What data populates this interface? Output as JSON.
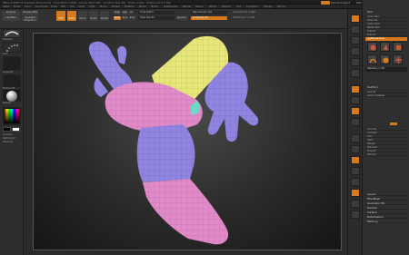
{
  "titlebar": {
    "app_title": "ZBrush 4R8 P2 [Sample Document] · Free Mem 2.3GB · Active Mem 685 · Scratch Disk 48 · Timer 0.029 · PolyCount 5.4 Mp",
    "quicksave_label": "QuickSave",
    "seethrough_label": "See-through 0",
    "menus_label": "Menus",
    "defaultscript_label": "DefaultZScript"
  },
  "menubar": {
    "items": [
      "Alpha",
      "Brush",
      "Color",
      "Document",
      "Draw",
      "Edit",
      "File",
      "Layer",
      "Light",
      "Macro",
      "Marker",
      "Material",
      "Movie",
      "Picker",
      "Preferences",
      "Render",
      "Stencil",
      "Stroke",
      "Texture",
      "Tool",
      "Transform",
      "Zplugin",
      "Zscript"
    ]
  },
  "toolbar": {
    "projects_label": "Projects",
    "lightbox_label": "LightBox",
    "preview_label": "Preview BPR",
    "spotlight_label": "Spotlight Projection",
    "edit_label": "Edit",
    "draw_label": "Draw",
    "move_label": "Move",
    "scale_label": "Scale",
    "rotate_label": "Rotate",
    "mrgb_label": "Mrgb",
    "rgb_label": "Rgb",
    "m_label": "M",
    "zadd_label": "Zadd",
    "zsub_label": "Zsub",
    "zcut_label": "Zcut",
    "focal_label": "Focal Shift 0",
    "draw_size_label": "Draw Size 64",
    "dynamic_label": "Dynamic",
    "rgb_intensity_label": "Rgb Intensity 100",
    "z_intensity_label": "Z Intensity 25",
    "active_points_label": "ActivePoints: 4,962",
    "total_points_label": "TotalPoints: 5.4 Mil"
  },
  "leftpanel": {
    "brush_label": "Standard",
    "stroke_label": "Dots",
    "alpha_label": "Alpha Off",
    "texture_label": "Texture Off",
    "material_label": "MatCap",
    "gradient_label": "Gradient",
    "switch_label": "SwitchColor",
    "alternate_label": "Alternate"
  },
  "rightstrip": {
    "items": [
      "BPR",
      "SPix 3",
      "Scroll",
      "Zoom",
      "Actual",
      "AAHalf",
      "Persp",
      "Floor",
      "Local",
      "L.Sym",
      "Frame",
      "Move",
      "Scale",
      "Rotate",
      "PolyF",
      "Transp",
      "Solo",
      "Xpose"
    ]
  },
  "tray": {
    "tool_title": "Tool",
    "load_label": "Load Tool",
    "save_label": "Save As",
    "copy_label": "Copy Tool",
    "paste_label": "Paste Tool",
    "import_label": "Import",
    "export_label": "Export",
    "clone_label": "Clone",
    "make_label": "Make PolyMesh3D",
    "goz_label": "GoZ",
    "all_label": "All",
    "visible_label": "Visible",
    "r_label": "R",
    "lightbox_tools": "Lightbox▸Tools",
    "current_tool": "ZSphere_1. 48",
    "subtools": [
      "SubTool",
      "Geometry",
      "ArrayMesh",
      "NanoMesh",
      "Layers",
      "FiberMesh",
      "Geometry HD",
      "Preview",
      "Surface",
      "Deformation",
      "Masking",
      "Visibility",
      "Polygroups",
      "Contact",
      "Morph Target",
      "Polypaint",
      "UV Map",
      "Texture Map",
      "Displacement Map",
      "Normal Map"
    ],
    "subtool_header": "SubTool",
    "subtool_items": [
      "List All",
      "Auto Collapse",
      "All Low",
      "All High",
      "Solo",
      "Split",
      "Merge",
      "Remesh",
      "Project",
      "Extract"
    ],
    "sections": [
      "Layers",
      "FiberMesh",
      "Geometry HD",
      "Preview",
      "Surface",
      "Deformation",
      "Masking"
    ]
  },
  "colors": {
    "accent": "#d77a1e",
    "mesh_yellow": "#e6e67a",
    "mesh_pink": "#e08ac8",
    "mesh_purple": "#8f84e0",
    "mesh_teal": "#6ed8c8"
  }
}
